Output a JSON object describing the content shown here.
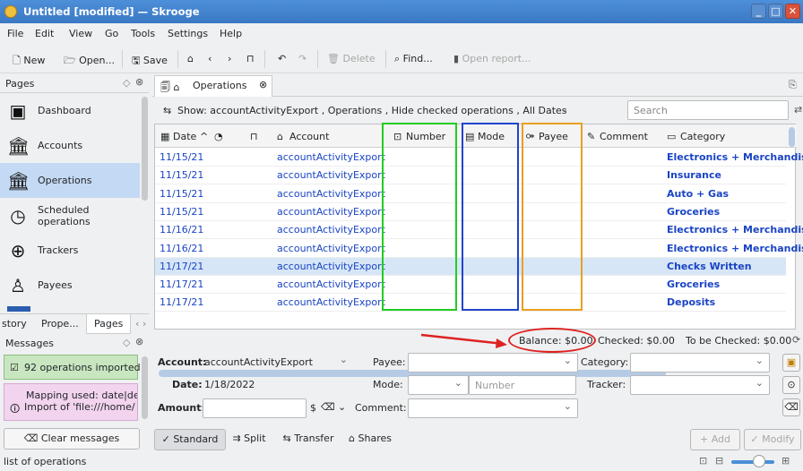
{
  "window": {
    "title": "Untitled [modified] — Skrooge"
  },
  "menu": [
    "File",
    "Edit",
    "View",
    "Go",
    "Tools",
    "Settings",
    "Help"
  ],
  "toolbar": {
    "new": "New",
    "open": "Open...",
    "save": "Save",
    "delete": "Delete",
    "find": "Find...",
    "open_report": "Open report..."
  },
  "pages_panel": {
    "title": "Pages",
    "items": [
      {
        "label": "Dashboard",
        "icon": "dashboard-icon"
      },
      {
        "label": "Accounts",
        "icon": "bank-icon"
      },
      {
        "label": "Operations",
        "icon": "bank-icon"
      },
      {
        "label": "Scheduled operations",
        "icon": "clock-icon"
      },
      {
        "label": "Trackers",
        "icon": "target-icon"
      },
      {
        "label": "Payees",
        "icon": "person-icon"
      }
    ]
  },
  "bottom_tabs": [
    "story",
    "Prope...",
    "Pages"
  ],
  "messages_panel": {
    "title": "Messages",
    "msg1": "92 operations imported",
    "msg2_line1": "Mapping used: date|de",
    "msg2_line2": "Import of 'file:///home/",
    "clear_button": "Clear messages"
  },
  "tab": {
    "label": "Operations"
  },
  "filter": {
    "text": "Show: accountActivityExport , Operations , Hide checked operations , All Dates",
    "search_placeholder": "Search"
  },
  "grid": {
    "columns": [
      "Date",
      "Account",
      "Number",
      "Mode",
      "Payee",
      "Comment",
      "Category"
    ],
    "rows": [
      {
        "date": "11/15/21",
        "account": "accountActivityExport",
        "category": "Electronics + Merchandis"
      },
      {
        "date": "11/15/21",
        "account": "accountActivityExport",
        "category": "Insurance"
      },
      {
        "date": "11/15/21",
        "account": "accountActivityExport",
        "category": "Auto + Gas"
      },
      {
        "date": "11/15/21",
        "account": "accountActivityExport",
        "category": "Groceries"
      },
      {
        "date": "11/16/21",
        "account": "accountActivityExport",
        "category": "Electronics + Merchandis"
      },
      {
        "date": "11/16/21",
        "account": "accountActivityExport",
        "category": "Electronics + Merchandis"
      },
      {
        "date": "11/17/21",
        "account": "accountActivityExport",
        "category": "Checks Written"
      },
      {
        "date": "11/17/21",
        "account": "accountActivityExport",
        "category": "Groceries"
      },
      {
        "date": "11/17/21",
        "account": "accountActivityExport",
        "category": "Deposits"
      }
    ],
    "selected_row": 6
  },
  "balance": {
    "balance": "Balance: $0.00",
    "checked": "Checked: $0.00",
    "to_be_checked": "To be Checked: $0.00"
  },
  "form": {
    "account_label": "Account:",
    "account_value": "accountActivityExport",
    "payee_label": "Payee:",
    "category_label": "Category:",
    "date_label": "Date:",
    "date_value": "1/18/2022",
    "mode_label": "Mode:",
    "number_placeholder": "Number",
    "tracker_label": "Tracker:",
    "amount_label": "Amount:",
    "currency": "$",
    "comment_label": "Comment:"
  },
  "mode_buttons": {
    "standard": "Standard",
    "split": "Split",
    "transfer": "Transfer",
    "shares": "Shares",
    "add": "+ Add",
    "modify": "✓ Modify"
  },
  "status": {
    "text": "list of operations"
  },
  "colors": {
    "highlight_number": "#22cc22",
    "highlight_mode": "#2244cc",
    "highlight_payee": "#e8a020",
    "annotation": "#dd2222",
    "link": "#1a44c4"
  }
}
